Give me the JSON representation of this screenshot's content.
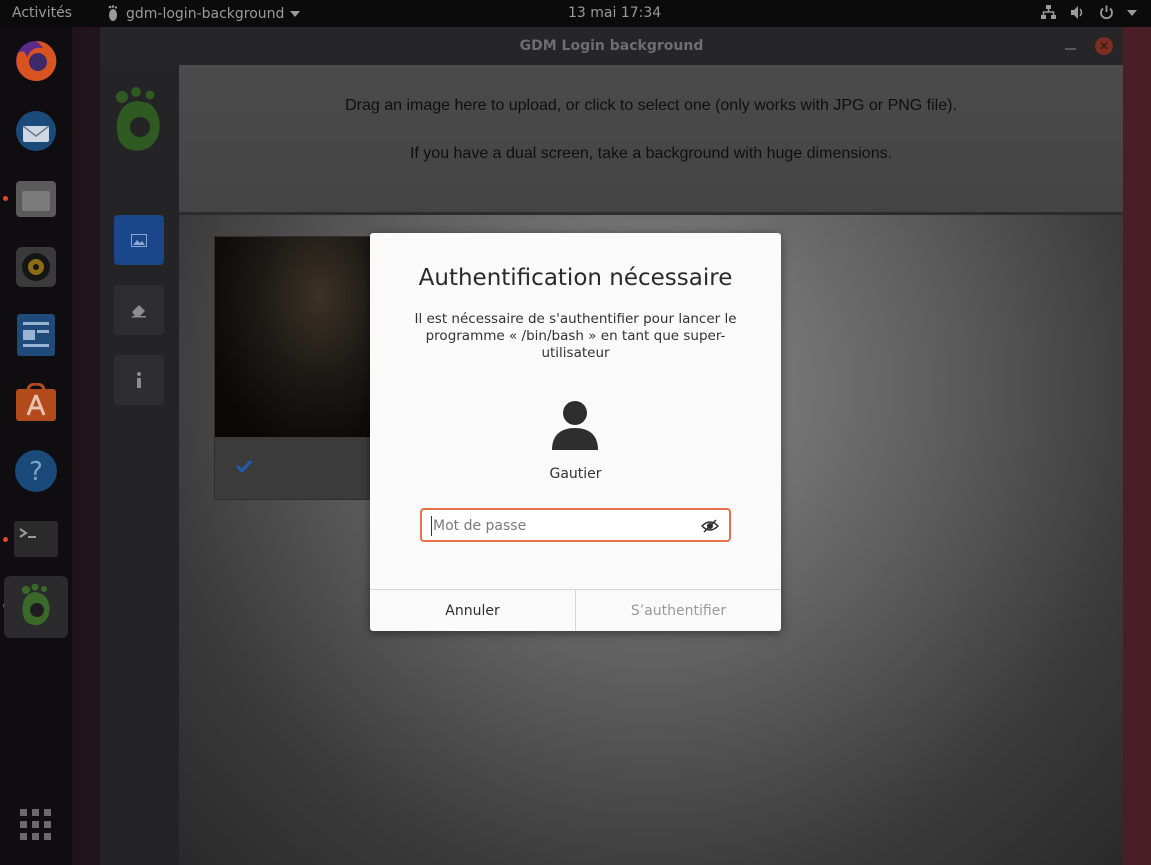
{
  "topbar": {
    "activities": "Activités",
    "app_name": "gdm-login-background",
    "clock": "13 mai  17:34"
  },
  "window": {
    "title": "GDM Login background",
    "dropzone_line1": "Drag an image here to upload, or click to select one (only works with JPG or PNG file).",
    "dropzone_line2": "If you have a dual screen, take a background with huge dimensions."
  },
  "dialog": {
    "title": "Authentification nécessaire",
    "message": "Il est nécessaire de s'authentifier pour lancer le programme « /bin/bash » en tant que super-utilisateur",
    "username": "Gautier",
    "password_placeholder": "Mot de passe",
    "password_value": "",
    "cancel_label": "Annuler",
    "authenticate_label": "S’authentifier"
  },
  "dock": {
    "items": [
      "firefox-icon",
      "thunderbird-icon",
      "files-icon",
      "rhythmbox-icon",
      "writer-icon",
      "software-icon",
      "help-icon",
      "terminal-icon",
      "gnome-foot-icon",
      "show-apps-icon"
    ]
  },
  "colors": {
    "accent": "#e9704a",
    "selected_sidebar": "#19478a",
    "close_button": "#7a2d20"
  }
}
